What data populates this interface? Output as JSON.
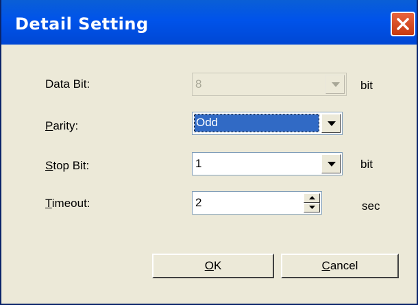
{
  "window": {
    "title": "Detail Setting"
  },
  "fields": {
    "data_bit": {
      "label": "Data Bit:",
      "value": "8",
      "unit": "bit",
      "enabled": false
    },
    "parity": {
      "label_accel": "P",
      "label_rest": "arity:",
      "value": "Odd",
      "selected": true
    },
    "stop_bit": {
      "label_accel": "S",
      "label_rest": "top Bit:",
      "value": "1",
      "unit": "bit"
    },
    "timeout": {
      "label_accel": "T",
      "label_rest": "imeout:",
      "value": "2",
      "unit": "sec"
    }
  },
  "buttons": {
    "ok": {
      "accel": "O",
      "rest": "K"
    },
    "cancel": {
      "accel": "C",
      "rest": "ancel"
    }
  },
  "icons": {
    "close": "close-x-icon",
    "dropdown": "chevron-down-icon",
    "spin_up": "arrow-up-icon",
    "spin_down": "arrow-down-icon"
  },
  "colors": {
    "titlebar": "#0053ea",
    "close_button": "#d84f24",
    "selection": "#316ac5",
    "dialog_bg": "#ece9d8"
  }
}
